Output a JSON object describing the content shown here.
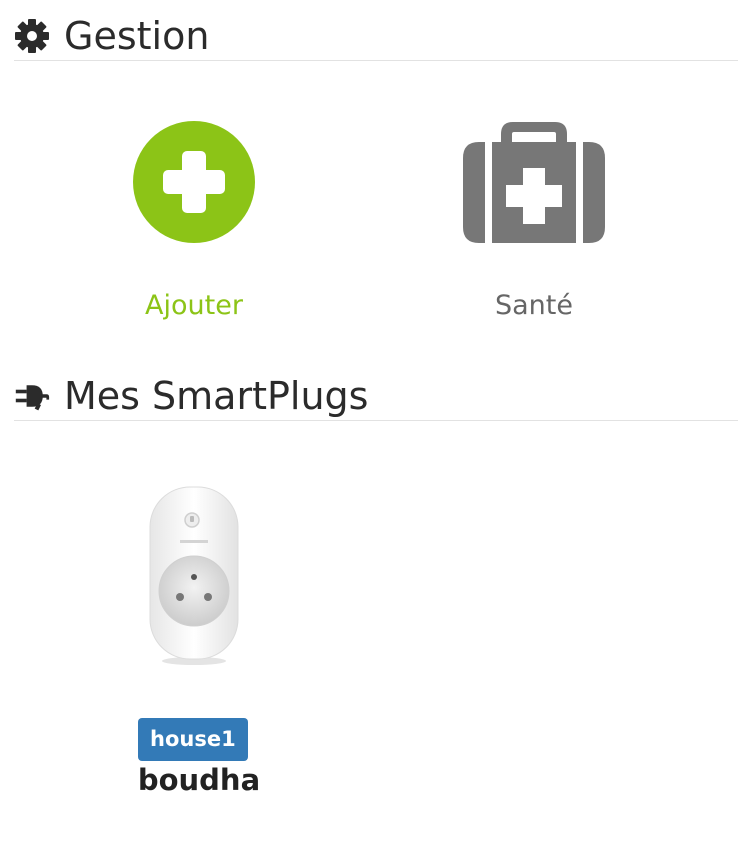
{
  "sections": {
    "gestion": {
      "title": "Gestion",
      "icon": "gear-icon"
    },
    "smartplugs": {
      "title": "Mes SmartPlugs",
      "icon": "plug-icon"
    }
  },
  "tiles": {
    "add": {
      "label": "Ajouter",
      "icon": "plus-circle-icon",
      "color": "#8cc417"
    },
    "health": {
      "label": "Santé",
      "icon": "medkit-icon",
      "color": "#777777"
    }
  },
  "plugs": [
    {
      "badge": "house1",
      "name": "boudha",
      "icon": "smartplug-image"
    }
  ],
  "colors": {
    "badge_bg": "#337ab7",
    "accent_green": "#8cc417",
    "icon_gray": "#777777"
  }
}
